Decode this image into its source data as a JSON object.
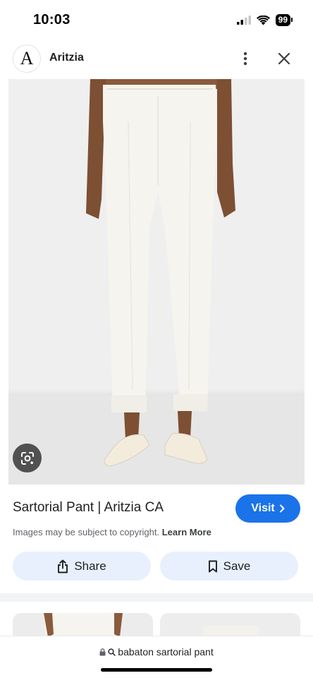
{
  "status_bar": {
    "time": "10:03",
    "battery": "99",
    "icons": [
      "cellular-signal-icon",
      "wifi-icon",
      "battery-icon"
    ]
  },
  "header": {
    "logo_letter": "A",
    "site_name": "Aritzia",
    "icons": [
      "more-vert-icon",
      "close-icon"
    ]
  },
  "image": {
    "lens_icon": "lens-search-icon"
  },
  "info": {
    "title": "Sartorial Pant | Aritzia CA",
    "visit_label": "Visit",
    "copyright_text": "Images may be subject to copyright.",
    "learn_more": "Learn More",
    "share_label": "Share",
    "save_label": "Save"
  },
  "bottom_bar": {
    "query": "babaton sartorial pant"
  },
  "colors": {
    "accent": "#1a73e8",
    "action_bg": "#e8f0fe",
    "image_bg": "#ededed"
  }
}
